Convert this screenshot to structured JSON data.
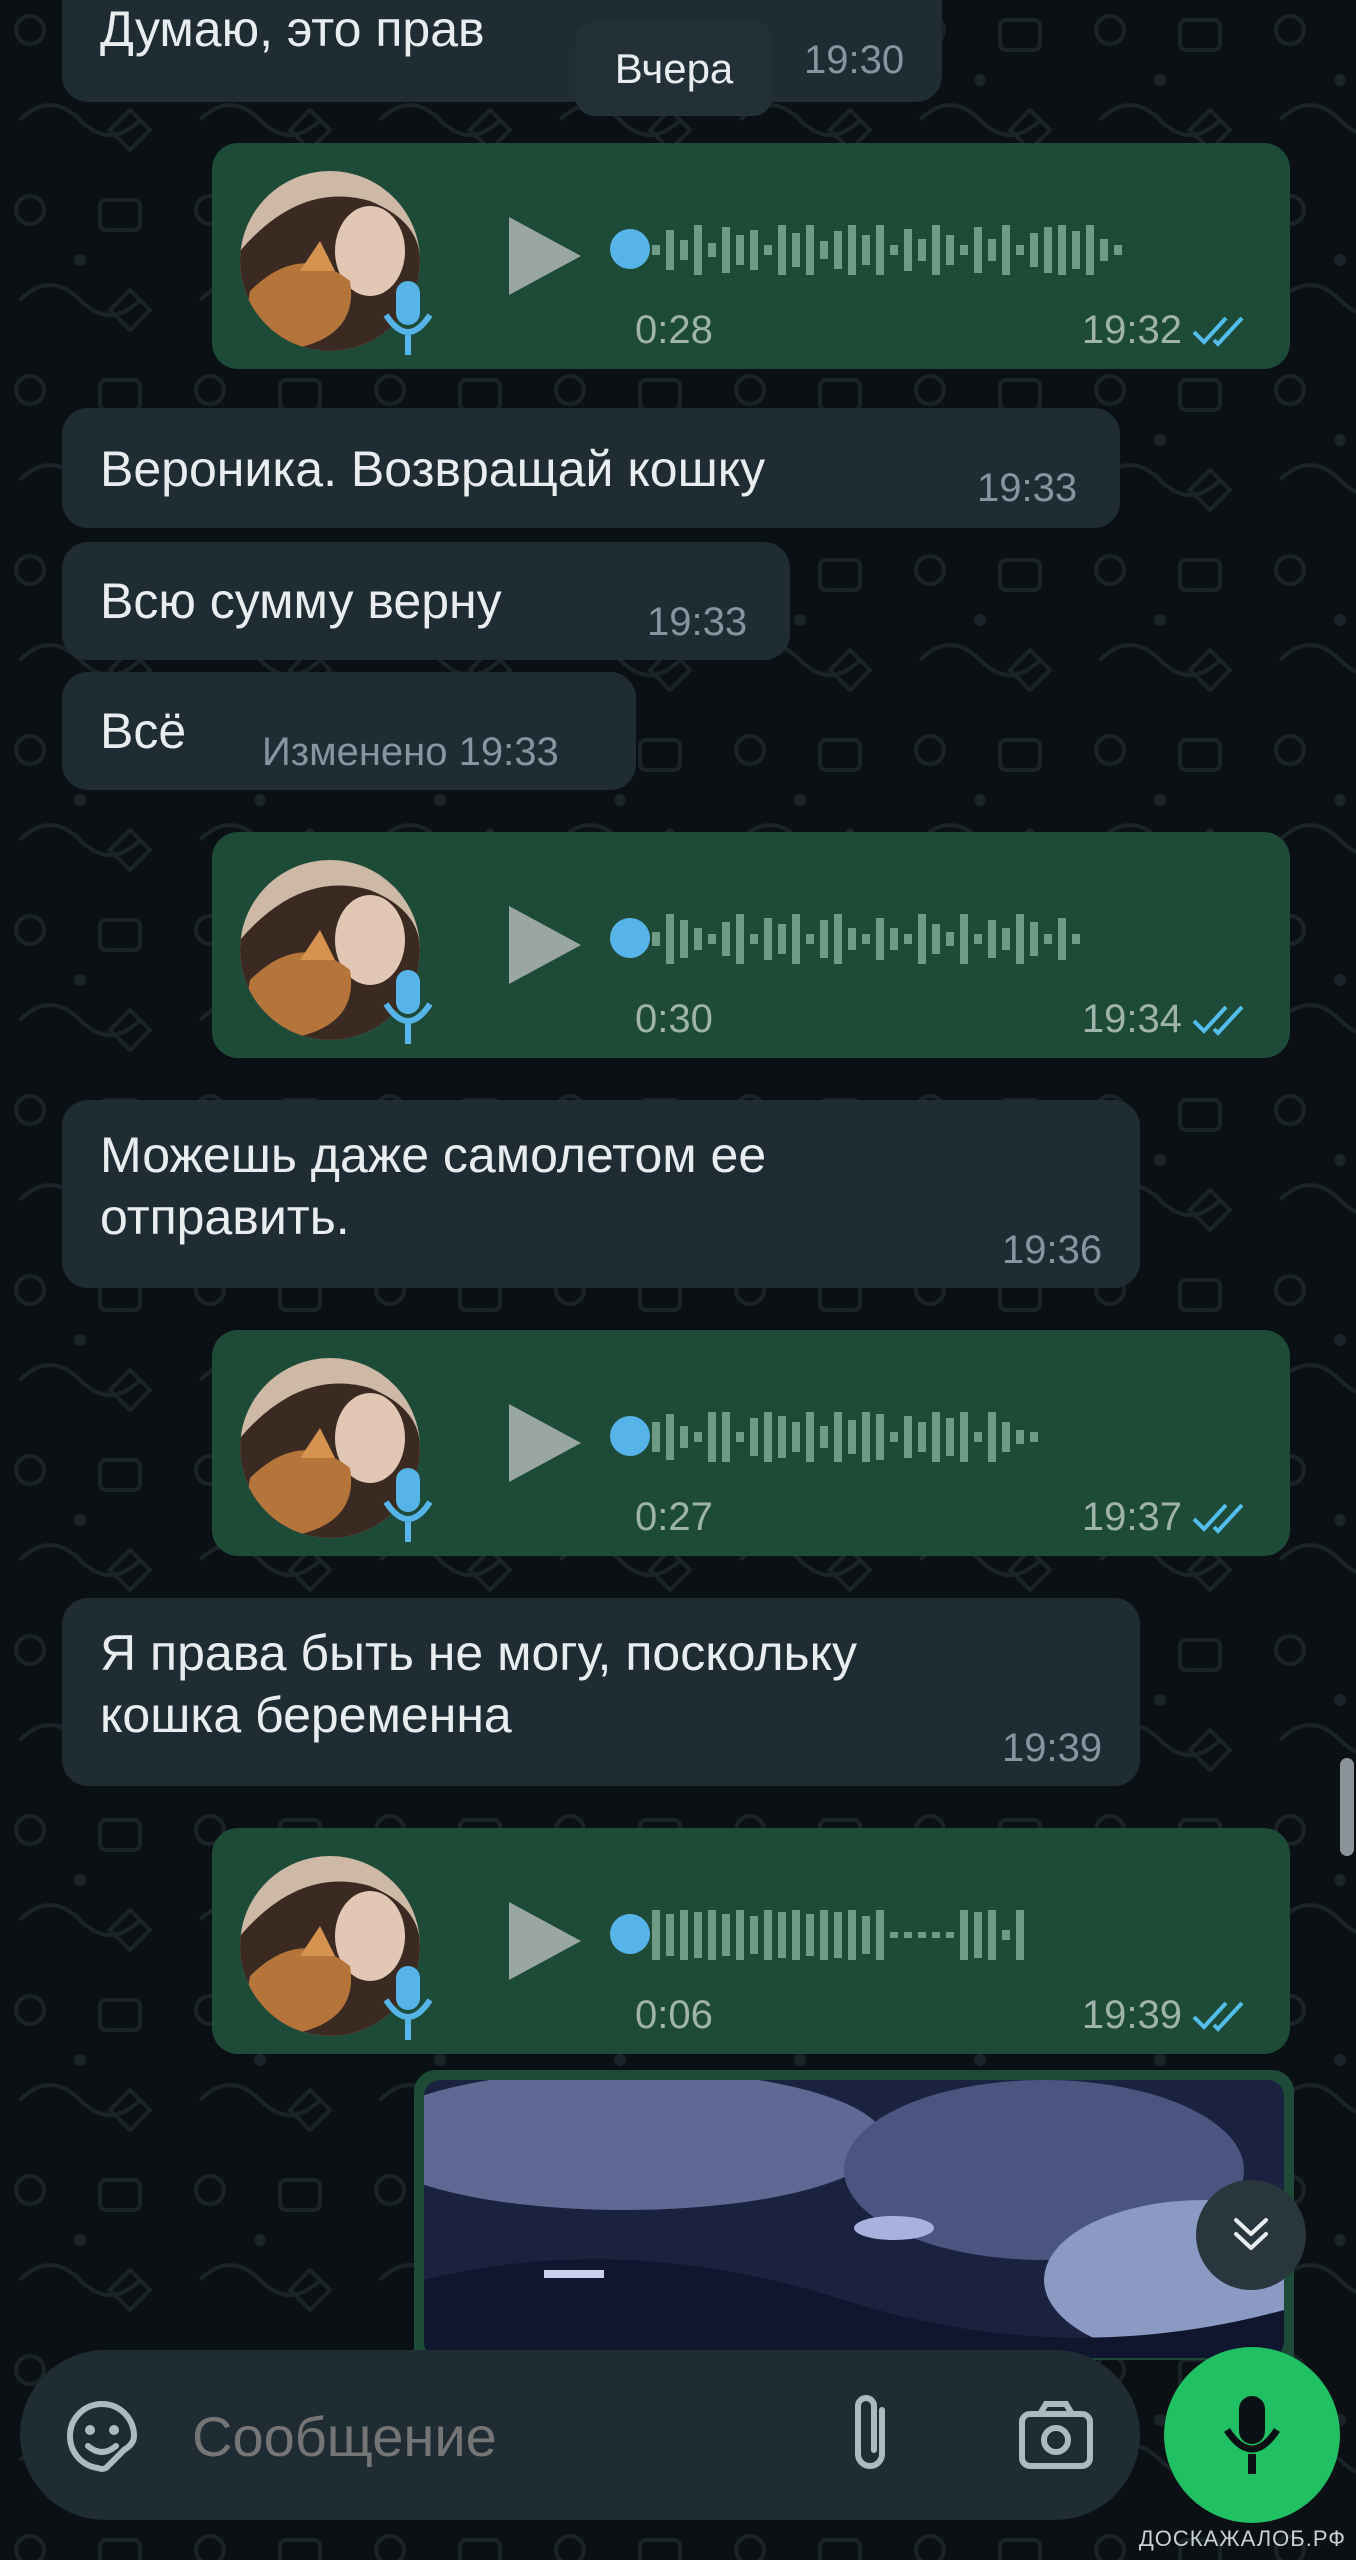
{
  "chat": {
    "date_separator": "Вчера",
    "messages": [
      {
        "type": "text",
        "direction": "incoming",
        "text": "Думаю, это прав",
        "time": "19:30"
      },
      {
        "type": "voice",
        "direction": "outgoing",
        "duration": "0:28",
        "time": "19:32",
        "status": "read"
      },
      {
        "type": "text",
        "direction": "incoming",
        "text": "Вероника. Возвращай кошку",
        "time": "19:33"
      },
      {
        "type": "text",
        "direction": "incoming",
        "text": "Всю сумму верну",
        "time": "19:33"
      },
      {
        "type": "text",
        "direction": "incoming",
        "text": "Всё",
        "time": "19:33",
        "edited_label": "Изменено"
      },
      {
        "type": "voice",
        "direction": "outgoing",
        "duration": "0:30",
        "time": "19:34",
        "status": "read"
      },
      {
        "type": "text",
        "direction": "incoming",
        "text": "Можешь даже самолетом ее\nотправить.",
        "time": "19:36"
      },
      {
        "type": "voice",
        "direction": "outgoing",
        "duration": "0:27",
        "time": "19:37",
        "status": "read"
      },
      {
        "type": "text",
        "direction": "incoming",
        "text": "Я права быть не могу, поскольку\nкошка беременна",
        "time": "19:39"
      },
      {
        "type": "voice",
        "direction": "outgoing",
        "duration": "0:06",
        "time": "19:39",
        "status": "read"
      },
      {
        "type": "image",
        "direction": "outgoing"
      }
    ]
  },
  "composer": {
    "placeholder": "Сообщение",
    "emoji_icon": "sticker-icon",
    "attach_icon": "paperclip-icon",
    "camera_icon": "camera-icon",
    "record_icon": "microphone-icon"
  },
  "watermark": "ДОСКАЖАЛОБ.РФ",
  "colors": {
    "background": "#0b1014",
    "incoming_bubble": "#202c33",
    "outgoing_bubble": "#1e4a38",
    "accent": "#21c063",
    "read_ticks": "#53bdeb"
  }
}
